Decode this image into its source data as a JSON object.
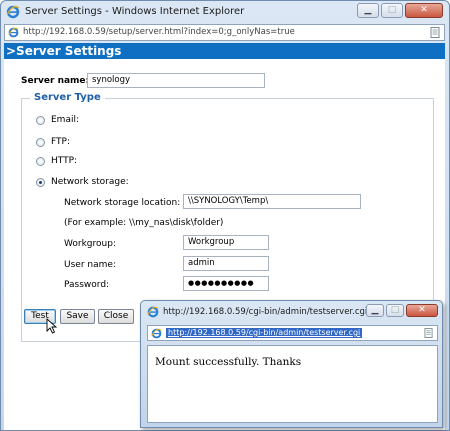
{
  "window": {
    "title": "Server Settings - Windows Internet Explorer",
    "address": "http://192.168.0.59/setup/server.html?index=0;g_onlyNas=true"
  },
  "page": {
    "banner": ">Server Settings",
    "server_name_label": "Server name:",
    "server_name_value": "synology",
    "server_type_legend": "Server Type",
    "options": {
      "email": "Email:",
      "ftp": "FTP:",
      "http": "HTTP:",
      "network_storage": "Network storage:"
    },
    "selected_option": "network_storage",
    "network": {
      "location_label": "Network storage location:",
      "location_value": "\\\\SYNOLOGY\\Temp\\",
      "example_text": "(For example: \\\\my_nas\\disk\\folder)",
      "workgroup_label": "Workgroup:",
      "workgroup_value": "Workgroup",
      "username_label": "User name:",
      "username_value": "admin",
      "password_label": "Password:",
      "password_value": "●●●●●●●●●●"
    },
    "buttons": {
      "test": "Test",
      "save": "Save",
      "close": "Close"
    }
  },
  "popup": {
    "title": "http://192.168.0.59/cgi-bin/admin/testserver.cgi - ...",
    "address": "http://192.168.0.59/cgi-bin/admin/testserver.cgi",
    "message": "Mount successfully. Thanks"
  },
  "icons": {
    "ie": "ie-logo-icon",
    "page": "page-icon",
    "cursor": "mouse-pointer-icon"
  },
  "colors": {
    "banner": "#0f6fc2",
    "legend": "#1f5fa6",
    "selection": "#3168c6",
    "close_button": "#c9573f"
  }
}
